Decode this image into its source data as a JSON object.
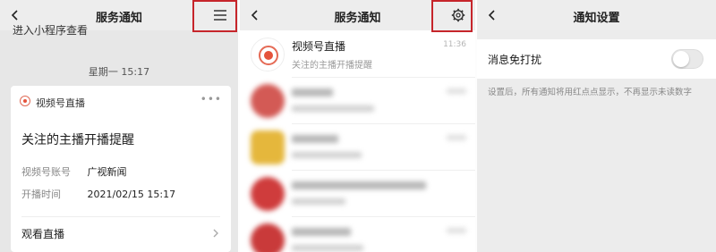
{
  "screen1": {
    "title": "服务通知",
    "top_partial": "进入小程序查看",
    "timestamp": "星期一 15:17",
    "card": {
      "source": "视频号直播",
      "more": "•••",
      "title": "关注的主播开播提醒",
      "fields": [
        {
          "key": "视频号账号",
          "value": "广视新闻"
        },
        {
          "key": "开播时间",
          "value": "2021/02/15 15:17"
        }
      ],
      "action": "观看直播"
    }
  },
  "screen2": {
    "title": "服务通知",
    "items": [
      {
        "title": "视频号直播",
        "subtitle": "关注的主播开播提醒",
        "time": "11:36"
      }
    ]
  },
  "screen3": {
    "title": "通知设置",
    "setting_label": "消息免打扰",
    "setting_enabled": false,
    "note": "设置后，所有通知将用红点点显示，不再显示未读数字"
  },
  "colors": {
    "highlight": "#c6252b",
    "live_red": "#e5533b",
    "navbar": "#ededed"
  },
  "icons": [
    "back-arrow-icon",
    "menu-icon",
    "settings-gear-icon",
    "live-icon",
    "chevron-right-icon"
  ]
}
